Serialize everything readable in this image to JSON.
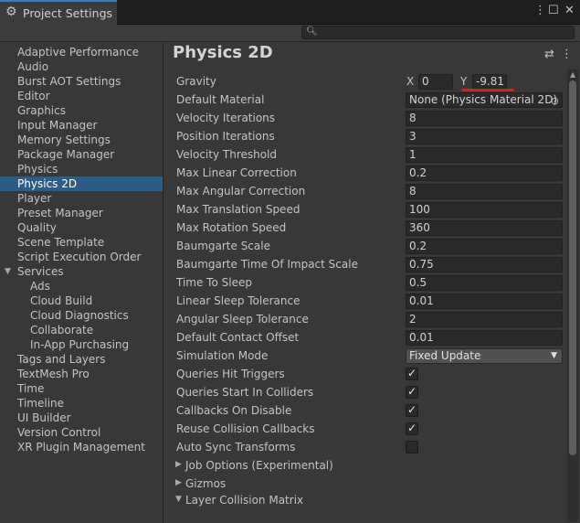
{
  "window": {
    "title": "Project Settings"
  },
  "search": {
    "placeholder": "",
    "value": ""
  },
  "sidebar": {
    "items": [
      {
        "label": "Adaptive Performance"
      },
      {
        "label": "Audio"
      },
      {
        "label": "Burst AOT Settings"
      },
      {
        "label": "Editor"
      },
      {
        "label": "Graphics"
      },
      {
        "label": "Input Manager"
      },
      {
        "label": "Memory Settings"
      },
      {
        "label": "Package Manager"
      },
      {
        "label": "Physics"
      },
      {
        "label": "Physics 2D",
        "selected": true
      },
      {
        "label": "Player"
      },
      {
        "label": "Preset Manager"
      },
      {
        "label": "Quality"
      },
      {
        "label": "Scene Template"
      },
      {
        "label": "Script Execution Order"
      },
      {
        "label": "Services",
        "expanded": true
      },
      {
        "label": "Ads"
      },
      {
        "label": "Cloud Build"
      },
      {
        "label": "Cloud Diagnostics"
      },
      {
        "label": "Collaborate"
      },
      {
        "label": "In-App Purchasing"
      },
      {
        "label": "Tags and Layers"
      },
      {
        "label": "TextMesh Pro"
      },
      {
        "label": "Time"
      },
      {
        "label": "Timeline"
      },
      {
        "label": "UI Builder"
      },
      {
        "label": "Version Control"
      },
      {
        "label": "XR Plugin Management"
      }
    ]
  },
  "main": {
    "title": "Physics 2D",
    "gravity": {
      "label": "Gravity",
      "x_label": "X",
      "x_value": "0",
      "y_label": "Y",
      "y_value": "-9.81"
    },
    "default_material": {
      "label": "Default Material",
      "value": "None (Physics Material 2D)"
    },
    "fields": [
      {
        "label": "Velocity Iterations",
        "value": "8"
      },
      {
        "label": "Position Iterations",
        "value": "3"
      },
      {
        "label": "Velocity Threshold",
        "value": "1"
      },
      {
        "label": "Max Linear Correction",
        "value": "0.2"
      },
      {
        "label": "Max Angular Correction",
        "value": "8"
      },
      {
        "label": "Max Translation Speed",
        "value": "100"
      },
      {
        "label": "Max Rotation Speed",
        "value": "360"
      },
      {
        "label": "Baumgarte Scale",
        "value": "0.2"
      },
      {
        "label": "Baumgarte Time Of Impact Scale",
        "value": "0.75"
      },
      {
        "label": "Time To Sleep",
        "value": "0.5"
      },
      {
        "label": "Linear Sleep Tolerance",
        "value": "0.01"
      },
      {
        "label": "Angular Sleep Tolerance",
        "value": "2"
      },
      {
        "label": "Default Contact Offset",
        "value": "0.01"
      }
    ],
    "simulation_mode": {
      "label": "Simulation Mode",
      "value": "Fixed Update"
    },
    "toggles": [
      {
        "label": "Queries Hit Triggers",
        "checked": true
      },
      {
        "label": "Queries Start In Colliders",
        "checked": true
      },
      {
        "label": "Callbacks On Disable",
        "checked": true
      },
      {
        "label": "Reuse Collision Callbacks",
        "checked": true
      },
      {
        "label": "Auto Sync Transforms",
        "checked": false
      }
    ],
    "foldouts": [
      {
        "label": "Job Options (Experimental)",
        "expanded": false
      },
      {
        "label": "Gizmos",
        "expanded": false
      },
      {
        "label": "Layer Collision Matrix",
        "expanded": true
      }
    ]
  },
  "colors": {
    "selection": "#2c5d87",
    "panel": "#383838",
    "annotation_underline": "#e0191e"
  }
}
